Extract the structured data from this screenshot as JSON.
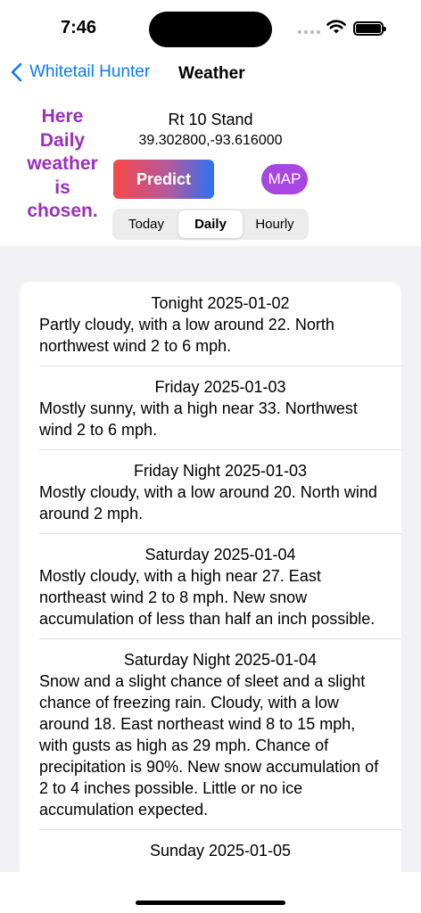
{
  "status": {
    "time": "7:46"
  },
  "nav": {
    "back_label": "Whitetail Hunter",
    "title": "Weather"
  },
  "note": {
    "text": "Here Daily weather is chosen."
  },
  "location": {
    "name": "Rt 10 Stand",
    "coords": "39.302800,-93.616000"
  },
  "buttons": {
    "predict": "Predict",
    "map": "MAP"
  },
  "segments": [
    "Today",
    "Daily",
    "Hourly"
  ],
  "selected_segment": "Daily",
  "forecast": [
    {
      "head": "Tonight  2025-01-02",
      "text": "Partly cloudy, with a low around 22. North northwest wind 2 to 6 mph."
    },
    {
      "head": "Friday  2025-01-03",
      "text": "Mostly sunny, with a high near 33. Northwest wind 2 to 6 mph."
    },
    {
      "head": "Friday Night  2025-01-03",
      "text": "Mostly cloudy, with a low around 20. North wind around 2 mph."
    },
    {
      "head": "Saturday  2025-01-04",
      "text": "Mostly cloudy, with a high near 27. East northeast wind 2 to 8 mph. New snow accumulation of less than half an inch possible."
    },
    {
      "head": "Saturday Night  2025-01-04",
      "text": "Snow and a slight chance of sleet and a slight chance of freezing rain. Cloudy, with a low around 18. East northeast wind 8 to 15 mph, with gusts as high as 29 mph. Chance of precipitation is 90%. New snow accumulation of 2 to 4 inches possible. Little or no ice accumulation expected."
    },
    {
      "head": "Sunday  2025-01-05",
      "text": ""
    }
  ],
  "colors": {
    "accent": "#0a7aff",
    "note": "#9b2fbf",
    "map": "#a746e0"
  }
}
